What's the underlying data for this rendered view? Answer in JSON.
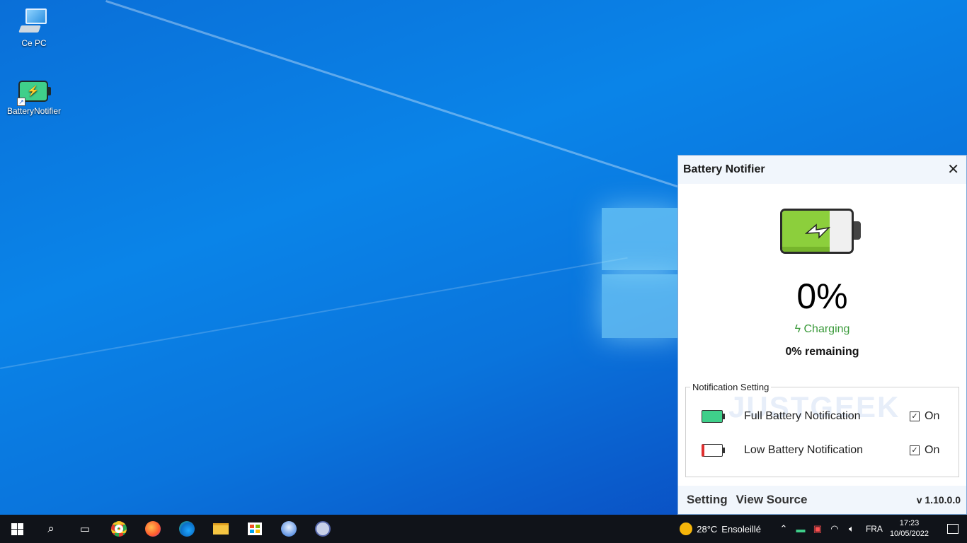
{
  "desktop": {
    "icons": [
      {
        "label": "Ce PC"
      },
      {
        "label": "BatteryNotifier"
      }
    ]
  },
  "panel": {
    "title": "Battery Notifier",
    "battery_level_fraction": 0.68,
    "percent": "0%",
    "status": "Charging",
    "remaining": "0% remaining",
    "group_label": "Notification Setting",
    "watermark": "JUSTGEEK",
    "rows": [
      {
        "label": "Full Battery Notification",
        "state": "On",
        "color": "#3fcf8a"
      },
      {
        "label": "Low Battery Notification",
        "state": "On",
        "color": "#e03030"
      }
    ],
    "footer": {
      "setting": "Setting",
      "view_source": "View Source",
      "version": "v 1.10.0.0"
    }
  },
  "taskbar": {
    "apps": [
      "start-icon",
      "search-icon",
      "task-view-icon",
      "chrome-icon",
      "firefox-icon",
      "edge-icon",
      "explorer-icon",
      "store-icon",
      "thunderbird-icon",
      "keepass-icon"
    ],
    "weather": {
      "temp": "28°C",
      "desc": "Ensoleillé"
    },
    "lang": "FRA",
    "time": "17:23",
    "date": "10/05/2022"
  }
}
